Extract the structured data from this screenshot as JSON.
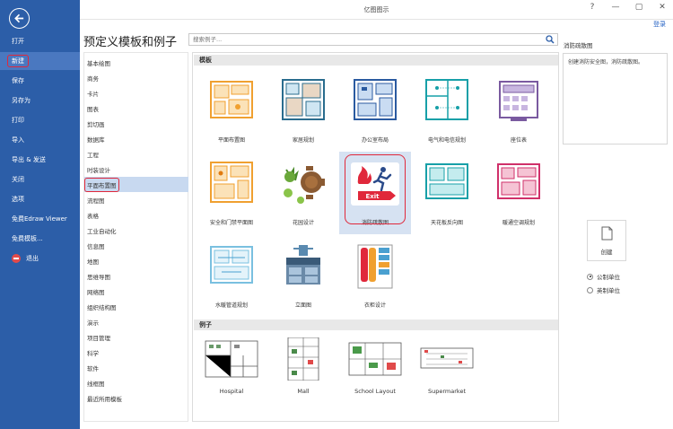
{
  "window": {
    "title": "亿图图示",
    "login": "登录",
    "controls": [
      "?",
      "—",
      "▢",
      "✕"
    ]
  },
  "leftnav": {
    "items": [
      {
        "label": "打开"
      },
      {
        "label": "新建"
      },
      {
        "label": "保存"
      },
      {
        "label": "另存为"
      },
      {
        "label": "打印"
      },
      {
        "label": "导入"
      },
      {
        "label": "导出 & 发送"
      },
      {
        "label": "关闭"
      },
      {
        "label": "选项"
      },
      {
        "label": "免费Edraw Viewer"
      },
      {
        "label": "免费模板..."
      },
      {
        "label": "退出"
      }
    ]
  },
  "header": {
    "title": "预定义模板和例子",
    "search_placeholder": "搜索例子..."
  },
  "categories": [
    "基本绘图",
    "商务",
    "卡片",
    "图表",
    "剪切画",
    "数据库",
    "工程",
    "时装设计",
    "平面布置图",
    "流程图",
    "表格",
    "工业自动化",
    "信息图",
    "地图",
    "思维导图",
    "网络图",
    "组织结构图",
    "演示",
    "项目管理",
    "科学",
    "软件",
    "线框图",
    "最近所用模板"
  ],
  "templates_section": "模板",
  "templates": [
    {
      "label": "平面布置图"
    },
    {
      "label": "家居规划"
    },
    {
      "label": "办公室布局"
    },
    {
      "label": "电气和电信规划"
    },
    {
      "label": "座位表"
    },
    {
      "label": "安全和门禁平面图"
    },
    {
      "label": "花园设计"
    },
    {
      "label": "消防疏散图",
      "exit_text": "Exit"
    },
    {
      "label": "天花板反向图"
    },
    {
      "label": "暖通空调规划"
    },
    {
      "label": "水暖管道规划"
    },
    {
      "label": "立面图"
    },
    {
      "label": "衣柜设计"
    }
  ],
  "examples_section": "例子",
  "examples": [
    {
      "label": "Hospital"
    },
    {
      "label": "Mall"
    },
    {
      "label": "School Layout"
    },
    {
      "label": "Supermarket"
    }
  ],
  "details": {
    "title": "消防疏散图",
    "description": "创建消防安全图，消防疏散图。",
    "create_label": "创建",
    "units": [
      {
        "label": "公制单位",
        "checked": true
      },
      {
        "label": "英制单位",
        "checked": false
      }
    ]
  },
  "colors": {
    "nav_bg": "#2c5ea8",
    "nav_active": "#4a78c0",
    "highlight": "#e0283b",
    "selected_tile": "#d6e2f2",
    "selected_cat": "#c8d9f0"
  },
  "icons": [
    "back-arrow-icon",
    "search-icon",
    "document-icon",
    "exit-icon"
  ]
}
